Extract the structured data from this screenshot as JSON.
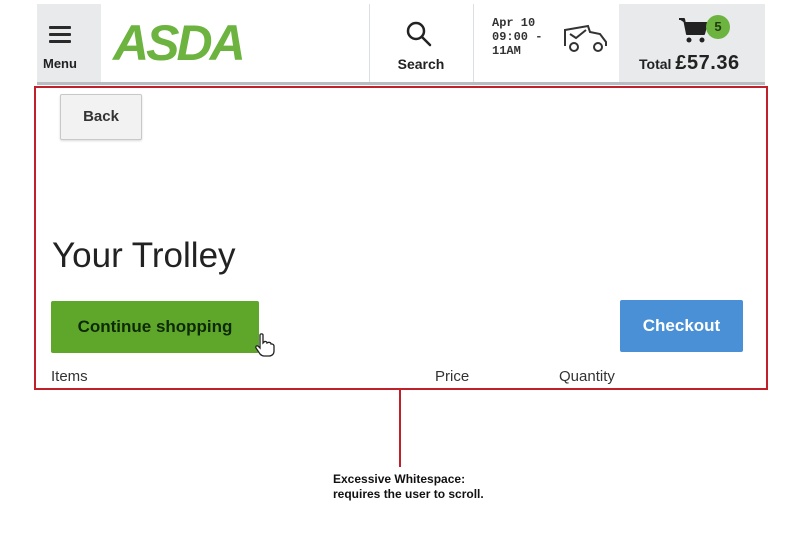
{
  "header": {
    "menu_label": "Menu",
    "logo_text": "ASDA",
    "search_label": "Search",
    "delivery_slot": [
      "Apr 10",
      "09:00 -",
      "11AM"
    ],
    "cart_count": "5",
    "total_label": "Total",
    "total_amount": "£57.36"
  },
  "page": {
    "back_label": "Back",
    "title": "Your Trolley",
    "continue_label": "Continue shopping",
    "checkout_label": "Checkout",
    "columns": [
      "Items",
      "Price",
      "Quantity"
    ]
  },
  "annotation": {
    "line1": "Excessive Whitespace:",
    "line2": "requires the user to scroll."
  },
  "colors": {
    "brand_green": "#6cb33f",
    "checkout_blue": "#4a90d6",
    "annotation_red": "#c0202a"
  }
}
